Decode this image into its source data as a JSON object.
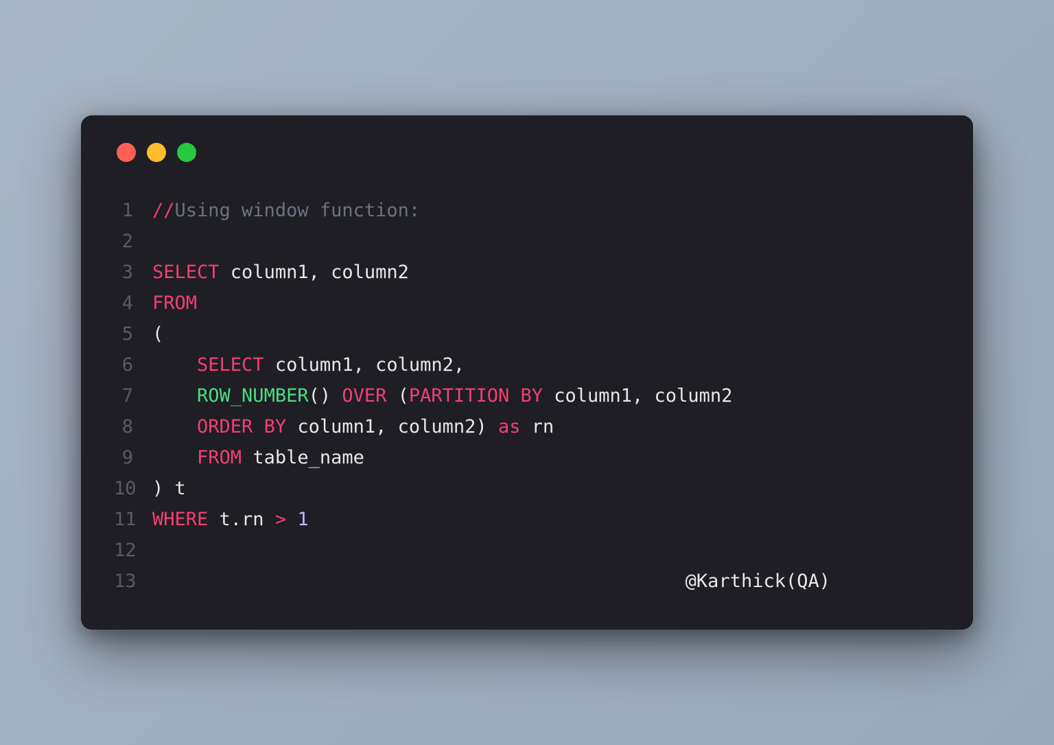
{
  "window": {
    "controls": [
      "red",
      "yellow",
      "green"
    ]
  },
  "code": {
    "lines": [
      {
        "num": "1"
      },
      {
        "num": "2"
      },
      {
        "num": "3"
      },
      {
        "num": "4"
      },
      {
        "num": "5"
      },
      {
        "num": "6"
      },
      {
        "num": "7"
      },
      {
        "num": "8"
      },
      {
        "num": "9"
      },
      {
        "num": "10"
      },
      {
        "num": "11"
      },
      {
        "num": "12"
      },
      {
        "num": "13"
      }
    ],
    "tokens": {
      "l1_slash": "//",
      "l1_comment": "Using window function:",
      "l3_select": "SELECT",
      "l3_cols": " column1, column2",
      "l4_from": "FROM",
      "l5_paren": "(",
      "l6_indent": "    ",
      "l6_select": "SELECT",
      "l6_cols": " column1, column2,",
      "l7_indent": "    ",
      "l7_fn": "ROW_NUMBER",
      "l7_parens": "()",
      "l7_over": " OVER ",
      "l7_open": "(",
      "l7_part": "PARTITION BY",
      "l7_cols": " column1, column2",
      "l8_indent": "    ",
      "l8_order": "ORDER BY",
      "l8_cols": " column1, column2",
      "l8_close": ")",
      "l8_as": " as ",
      "l8_rn": "rn",
      "l9_indent": "    ",
      "l9_from": "FROM",
      "l9_table": " table_name",
      "l10_close": ")",
      "l10_t": " t",
      "l11_where": "WHERE",
      "l11_expr": " t.rn ",
      "l11_op": ">",
      "l11_sp": " ",
      "l11_num": "1",
      "l13_attr": "@Karthick(QA)"
    }
  }
}
